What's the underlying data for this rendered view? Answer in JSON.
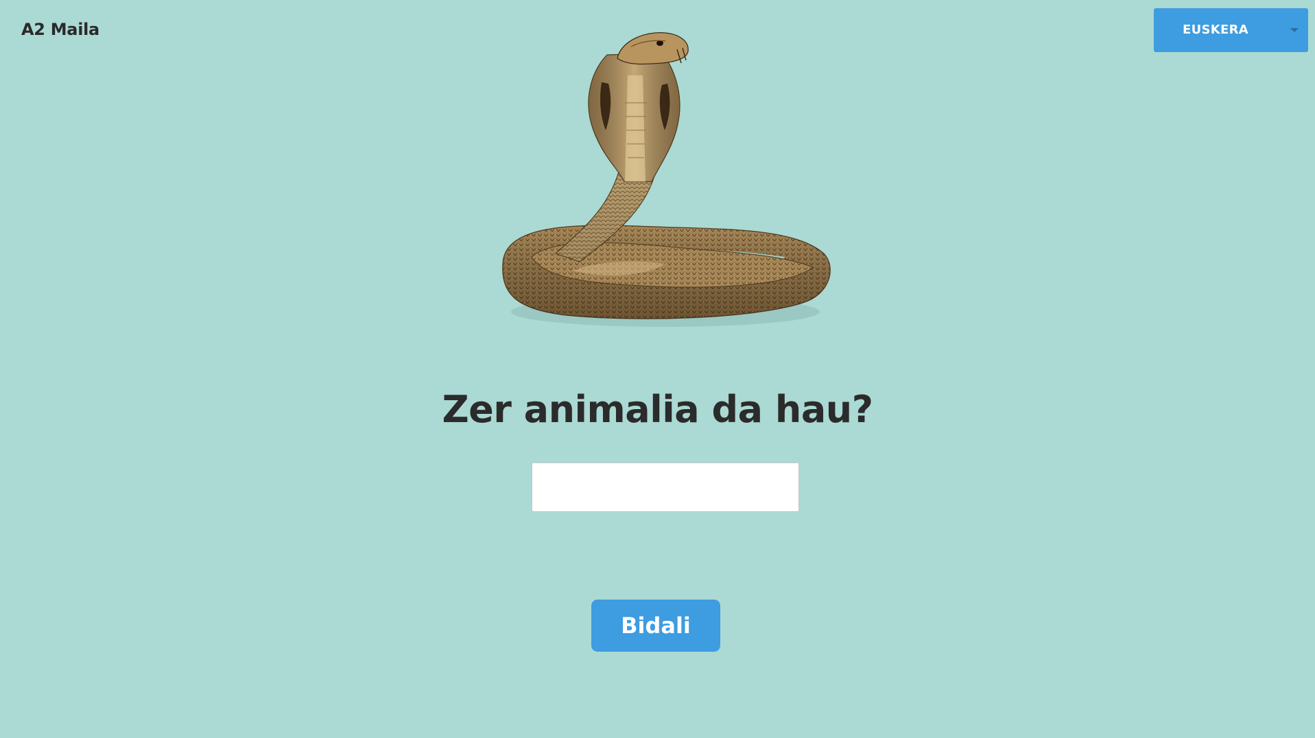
{
  "header": {
    "level_label": "A2 Maila"
  },
  "language_select": {
    "selected": "EUSKERA",
    "icon": "chevron-down-icon"
  },
  "quiz": {
    "image_subject": "cobra-snake",
    "question": "Zer animalia da hau?",
    "answer_value": "",
    "answer_placeholder": "",
    "submit_label": "Bidali"
  },
  "colors": {
    "background": "#abd9d4",
    "accent": "#3e9ce0",
    "text": "#2b2b2b"
  }
}
